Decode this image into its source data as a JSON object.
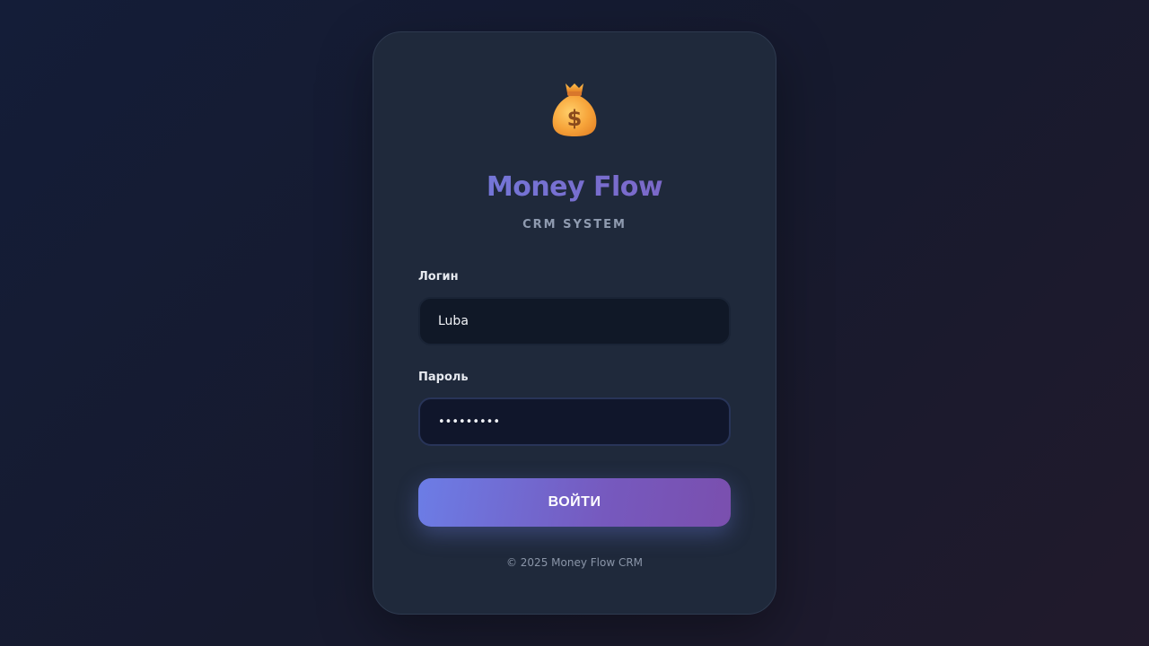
{
  "brand": {
    "logo_icon": "money-bag-icon",
    "title": "Money Flow",
    "subtitle": "CRM SYSTEM"
  },
  "form": {
    "login_label": "Логин",
    "login_value": "Luba",
    "password_label": "Пароль",
    "password_mask": "•••••••••",
    "submit_label": "ВОЙТИ"
  },
  "footer": {
    "copyright": "© 2025 Money Flow CRM"
  },
  "colors": {
    "accent_start": "#6c7de6",
    "accent_end": "#7a4fae",
    "card_bg": "#1f293b",
    "input_bg": "#101827"
  }
}
